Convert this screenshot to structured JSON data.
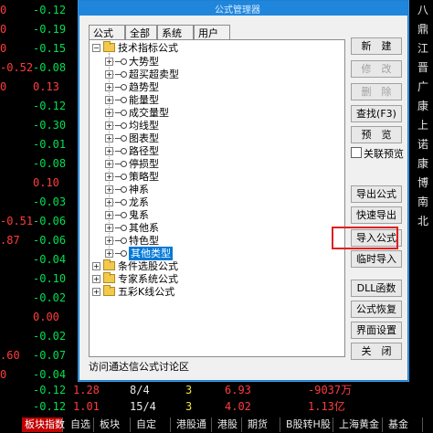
{
  "background": {
    "rows": [
      {
        "a": "-0.12",
        "b": "",
        "r": "八"
      },
      {
        "a": "-0.19",
        "b": "",
        "r": "鼎"
      },
      {
        "a": "-0.15",
        "b": "",
        "r": "江"
      },
      {
        "a": "-0.08",
        "b": "",
        "r": "晋"
      },
      {
        "a": "0.13",
        "b": "",
        "r": "广"
      },
      {
        "a": "-0.12",
        "b": "",
        "r": "康"
      },
      {
        "a": "-0.30",
        "b": "",
        "r": "上"
      },
      {
        "a": "-0.01",
        "b": "",
        "r": "诺"
      },
      {
        "a": "-0.08",
        "b": "",
        "r": "康"
      },
      {
        "a": "0.10",
        "b": "",
        "r": "博"
      },
      {
        "a": "-0.03",
        "b": "",
        "r": "南"
      },
      {
        "a": "-0.06",
        "b": "",
        "r": "北"
      },
      {
        "a": "-0.06",
        "b": "",
        "r": ""
      },
      {
        "a": "-0.04",
        "b": "",
        "r": ""
      },
      {
        "a": "-0.10",
        "b": "",
        "r": ""
      },
      {
        "a": "-0.02",
        "b": "",
        "r": ""
      },
      {
        "a": "0.00",
        "b": "",
        "r": ""
      },
      {
        "a": "-0.02",
        "b": "",
        "r": ""
      },
      {
        "a": "-0.07",
        "b": "",
        "r": ""
      },
      {
        "a": "-0.04",
        "b": "",
        "r": ""
      }
    ],
    "left_col": [
      "0",
      "0",
      "0",
      "-0.52",
      "0",
      "",
      "",
      "",
      "",
      "",
      "",
      "-0.51",
      ".87",
      "",
      "",
      "",
      "",
      "",
      ".60",
      "0"
    ],
    "bottom_rows": [
      {
        "c1": "-0.12",
        "c2": "1.28",
        "c3": "8/4",
        "c4": "3",
        "c5": "6.93",
        "c6": "-9037万"
      },
      {
        "c1": "-0.12",
        "c2": "1.01",
        "c3": "15/4",
        "c4": "3",
        "c5": "4.02",
        "c6": "1.13亿"
      }
    ]
  },
  "dialog": {
    "title": "公式管理器",
    "tabs": [
      "公式组",
      "全部",
      "系统",
      "用户"
    ],
    "tree": {
      "root": "技术指标公式",
      "children": [
        "大势型",
        "超买超卖型",
        "趋势型",
        "能量型",
        "成交量型",
        "均线型",
        "图表型",
        "路径型",
        "停损型",
        "策略型",
        "神系",
        "龙系",
        "鬼系",
        "其他系",
        "特色型",
        "其他类型"
      ],
      "selected_index": 15,
      "siblings": [
        "条件选股公式",
        "专家系统公式",
        "五彩K线公式"
      ]
    },
    "status_text": "访问通达信公式讨论区",
    "buttons": {
      "new": "新　建",
      "modify": "修　改",
      "delete": "删　除",
      "find": "查找(F3)",
      "preview": "预　览",
      "export": "导出公式",
      "quick_export": "快速导出",
      "import": "导入公式",
      "temp_import": "临时导入",
      "dll": "DLL函数",
      "restore": "公式恢复",
      "ui_settings": "界面设置",
      "close": "关　闭"
    },
    "checkbox": {
      "label": "关联预览",
      "checked": false
    }
  },
  "bottom_tabs": [
    "板块指数",
    "自选",
    "板块",
    "自定",
    "港股通",
    "港股",
    "期货",
    "B股转H股",
    "上海黄金",
    "基金"
  ],
  "active_bottom_tab": 0,
  "colors": {
    "accent_blue": "#1f86dc",
    "highlight_red": "#e02020",
    "selection": "#0078d7"
  }
}
